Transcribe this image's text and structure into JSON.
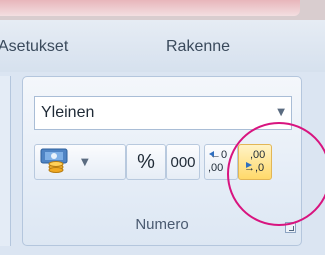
{
  "tabs": {
    "asetukset": "Asetukset",
    "rakenne": "Rakenne"
  },
  "number_group": {
    "format_value": "Yleinen",
    "percent_label": "%",
    "comma_label": "000",
    "increase_decimal_top": "←0",
    "increase_decimal_bottom": ",00",
    "decrease_decimal_top": ",00",
    "decrease_decimal_bottom": "→,0",
    "group_label": "Numero"
  },
  "colors": {
    "highlight_circle": "#d8147f",
    "active_button": "#ffd96a"
  },
  "icons": [
    "accounting-format-icon",
    "dropdown-arrow-icon",
    "increase-decimal-icon",
    "decrease-decimal-icon",
    "dialog-launcher-icon"
  ]
}
